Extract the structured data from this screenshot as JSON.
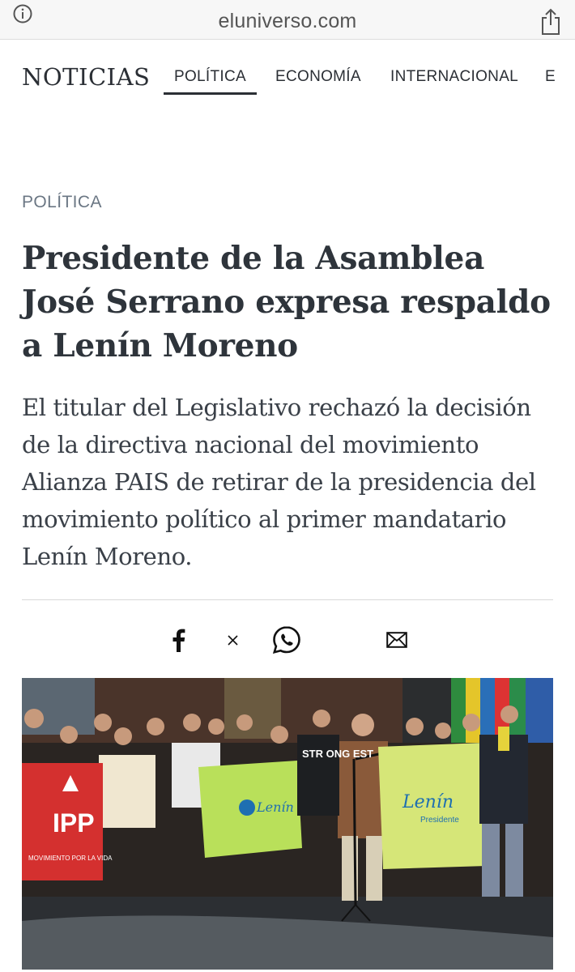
{
  "browser": {
    "url": "eluniverso.com",
    "icons": {
      "info": "info-icon",
      "share": "share-icon"
    }
  },
  "nav": {
    "brand": "NOTICIAS",
    "tabs": [
      {
        "label": "POLÍTICA",
        "active": true
      },
      {
        "label": "ECONOMÍA",
        "active": false
      },
      {
        "label": "INTERNACIONAL",
        "active": false
      },
      {
        "label": "E",
        "active": false
      }
    ]
  },
  "article": {
    "section": "POLÍTICA",
    "headline": "Presidente de la Asamblea José Serrano expresa respaldo a Lenín Moreno",
    "summary": "El titular del Legislativo rechazó la decisión de la directiva nacional del movimiento Alianza PAIS de retirar de la presidencia del movimiento político al primer mandatario Lenín Moreno.",
    "share": [
      "facebook-icon",
      "x-icon",
      "whatsapp-icon",
      "email-icon"
    ],
    "photo": {
      "banner_left": "IPP",
      "banner_left_sub": "MOVIMIENTO POR LA VIDA",
      "banner_center": "Lenín",
      "banner_right": "Lenín",
      "banner_right_sub": "Presidente",
      "shirt_text": "STR ONG EST"
    }
  },
  "colors": {
    "text": "#2e343b",
    "kicker": "#6b7784",
    "banner_green": "#b9e05a",
    "banner_red": "#d4302f"
  }
}
